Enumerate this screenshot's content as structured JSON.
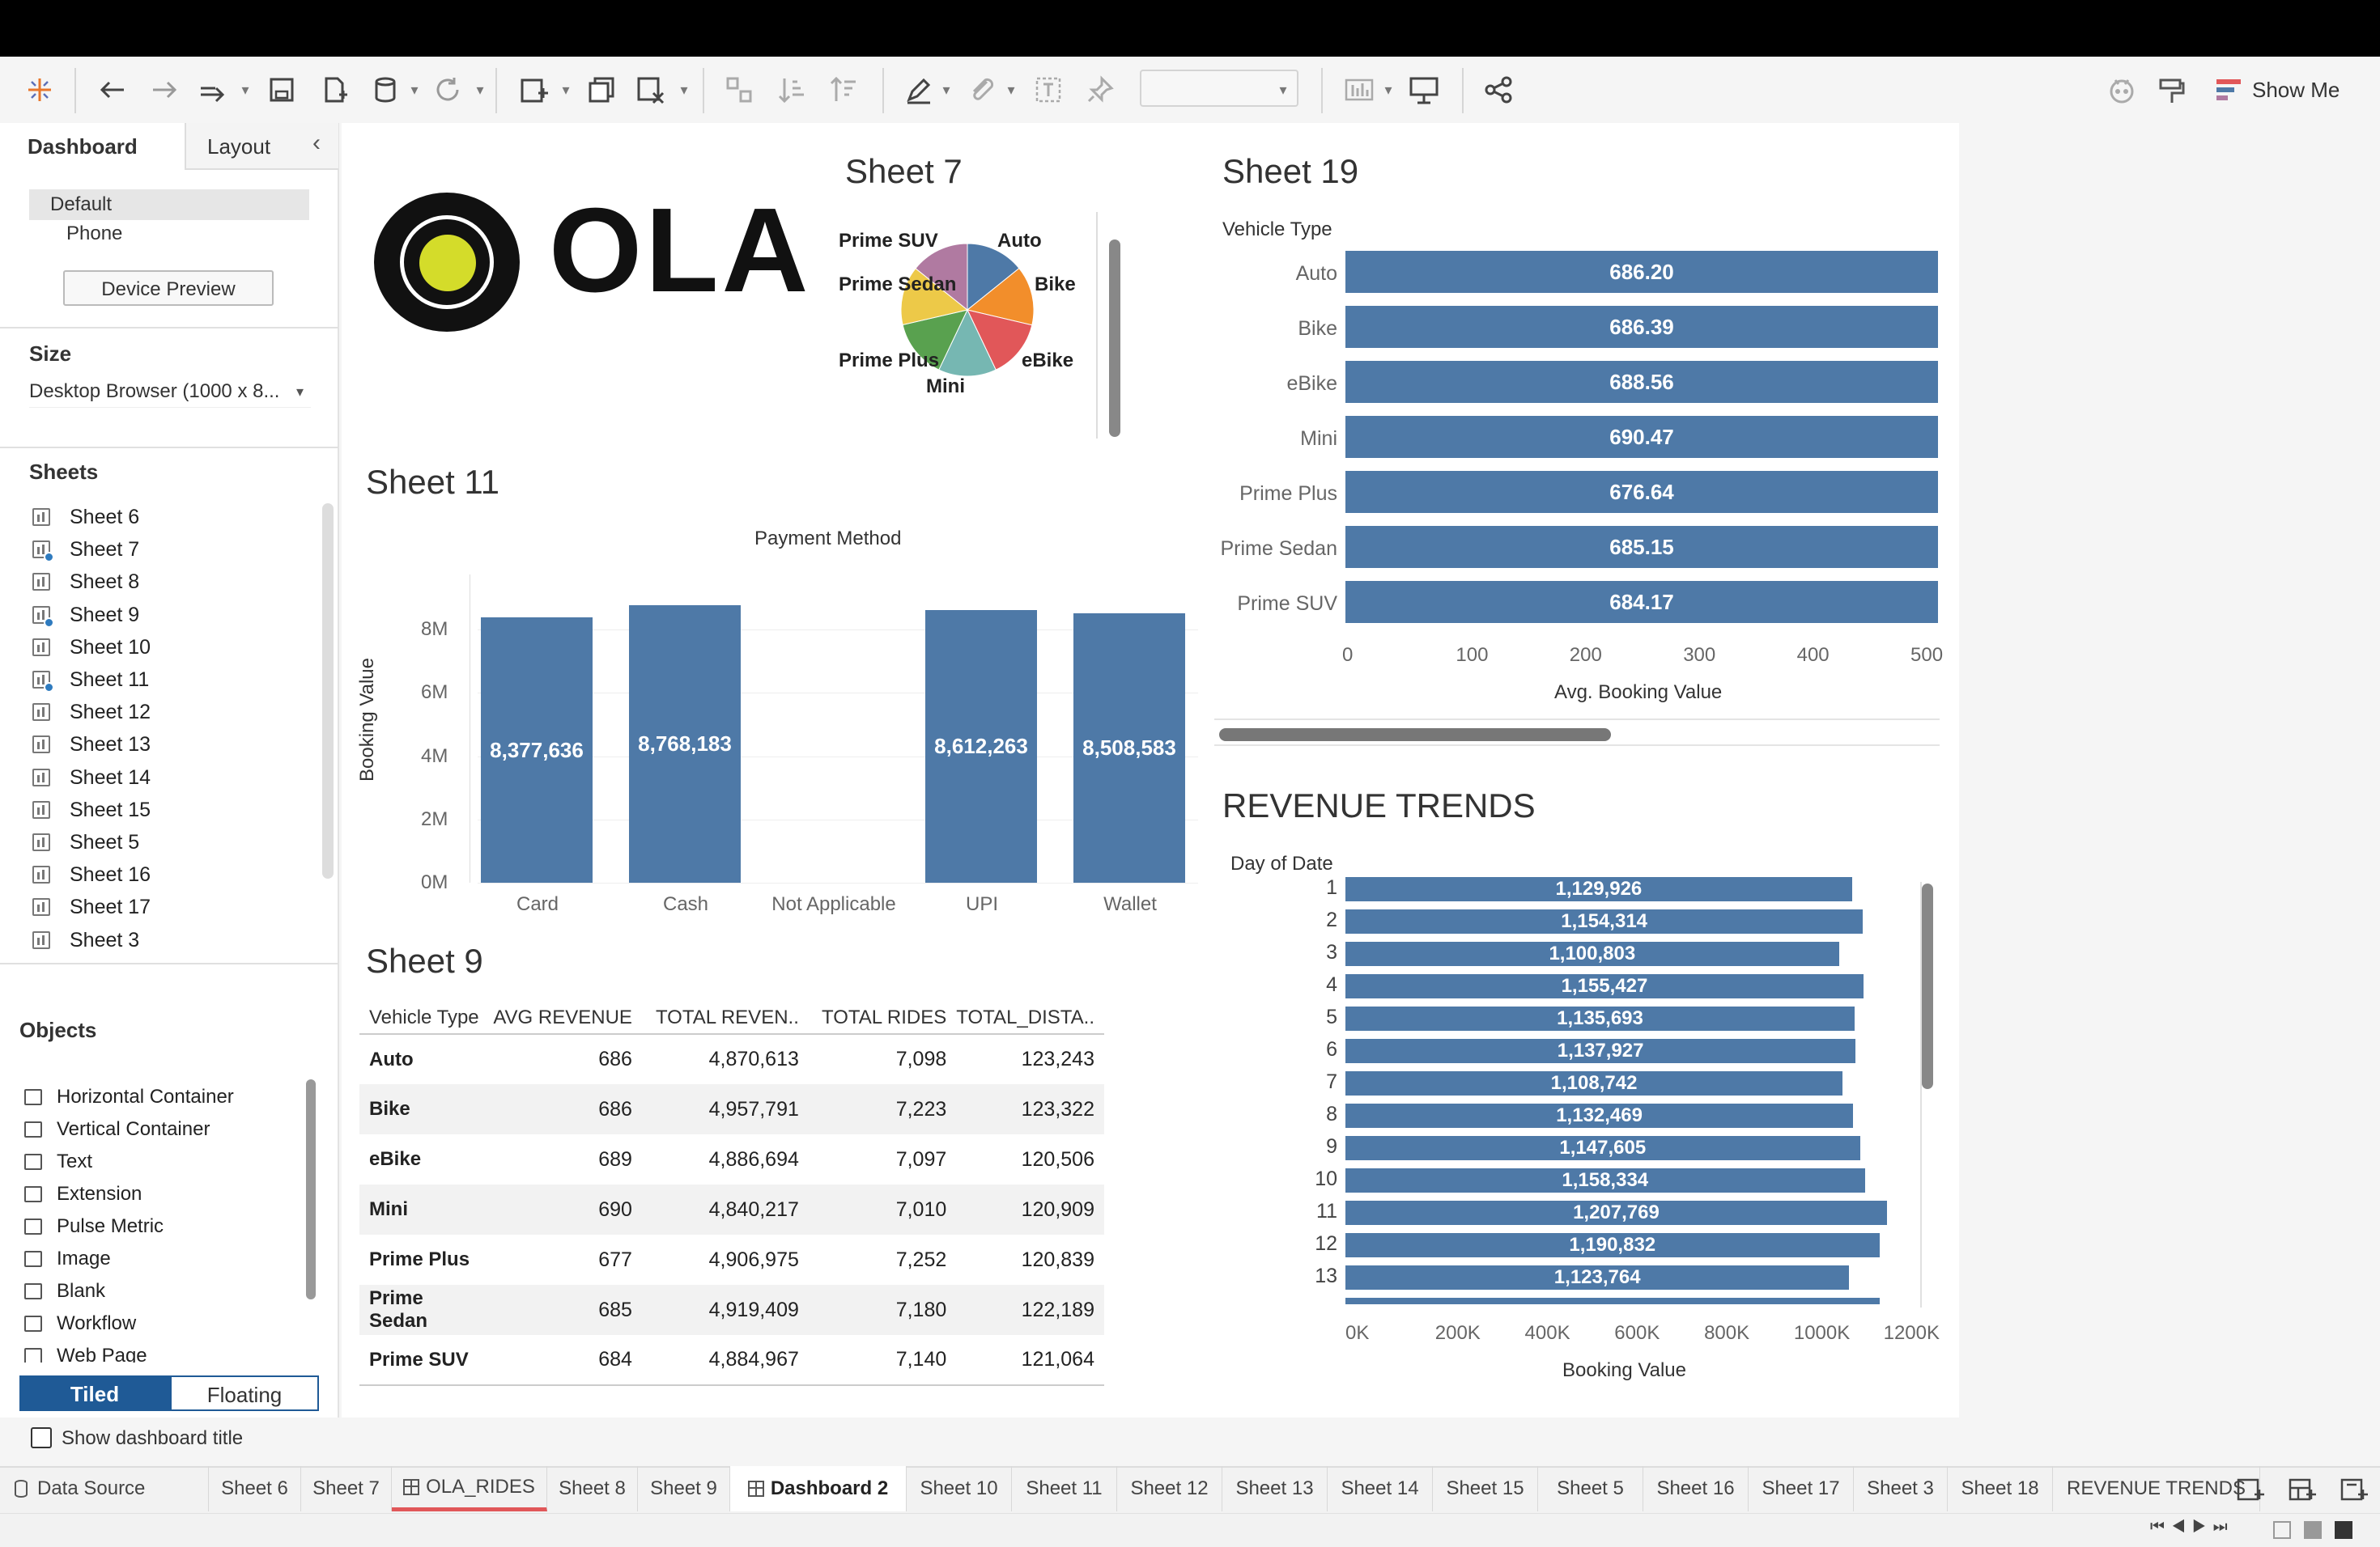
{
  "toolbar": {
    "show_me": "Show Me"
  },
  "sidebar": {
    "tabs": {
      "dashboard": "Dashboard",
      "layout": "Layout"
    },
    "devices": {
      "default": "Default",
      "phone": "Phone",
      "preview": "Device Preview"
    },
    "size": {
      "title": "Size",
      "value": "Desktop Browser (1000 x 8..."
    },
    "sheets": {
      "title": "Sheets",
      "items": [
        "Sheet 6",
        "Sheet 7",
        "Sheet 8",
        "Sheet 9",
        "Sheet 10",
        "Sheet 11",
        "Sheet 12",
        "Sheet 13",
        "Sheet 14",
        "Sheet 15",
        "Sheet 5",
        "Sheet 16",
        "Sheet 17",
        "Sheet 3"
      ],
      "used": [
        false,
        true,
        false,
        true,
        false,
        true,
        false,
        false,
        false,
        false,
        false,
        false,
        false,
        false
      ]
    },
    "objects": {
      "title": "Objects",
      "items": [
        "Horizontal Container",
        "Vertical Container",
        "Text",
        "Extension",
        "Pulse Metric",
        "Image",
        "Blank",
        "Workflow",
        "Web Page"
      ],
      "icons": [
        "horizontal-container-icon",
        "vertical-container-icon",
        "text-icon",
        "extension-icon",
        "pulse-metric-icon",
        "image-icon",
        "blank-icon",
        "workflow-icon",
        "web-page-icon"
      ]
    },
    "tiled": "Tiled",
    "floating": "Floating",
    "show_title": "Show dashboard title"
  },
  "logo": {
    "text": "OLA"
  },
  "sheet7": {
    "title": "Sheet 7",
    "labels": [
      "Prime SUV",
      "Auto",
      "Prime Sedan",
      "Bike",
      "Prime Plus",
      "eBike",
      "Mini"
    ]
  },
  "sheet19": {
    "title": "Sheet 19",
    "header": "Vehicle Type",
    "xlabel": "Avg. Booking Value",
    "ticks": [
      "0",
      "100",
      "200",
      "300",
      "400",
      "500"
    ]
  },
  "sheet11": {
    "title": "Sheet 11",
    "header": "Payment Method",
    "ylabel": "Booking Value",
    "yticks": [
      "8M",
      "6M",
      "4M",
      "2M",
      "0M"
    ]
  },
  "sheet9": {
    "title": "Sheet 9",
    "columns": [
      "Vehicle Type",
      "AVG REVENUE",
      "TOTAL REVEN..",
      "TOTAL RIDES",
      "TOTAL_DISTA.."
    ],
    "rows": [
      [
        "Auto",
        "686",
        "4,870,613",
        "7,098",
        "123,243"
      ],
      [
        "Bike",
        "686",
        "4,957,791",
        "7,223",
        "123,322"
      ],
      [
        "eBike",
        "689",
        "4,886,694",
        "7,097",
        "120,506"
      ],
      [
        "Mini",
        "690",
        "4,840,217",
        "7,010",
        "120,909"
      ],
      [
        "Prime Plus",
        "677",
        "4,906,975",
        "7,252",
        "120,839"
      ],
      [
        "Prime Sedan",
        "685",
        "4,919,409",
        "7,180",
        "122,189"
      ],
      [
        "Prime SUV",
        "684",
        "4,884,967",
        "7,140",
        "121,064"
      ]
    ]
  },
  "revenue": {
    "title": "REVENUE TRENDS",
    "header": "Day of Date",
    "xlabel": "Booking Value",
    "ticks": [
      "0K",
      "200K",
      "400K",
      "600K",
      "800K",
      "1000K",
      "1200K"
    ]
  },
  "chart_data": [
    {
      "type": "pie",
      "title": "Sheet 7",
      "categories": [
        "Auto",
        "Bike",
        "eBike",
        "Mini",
        "Prime Plus",
        "Prime Sedan",
        "Prime SUV"
      ],
      "values": [
        4870613,
        4957791,
        4886694,
        4840217,
        4906975,
        4919409,
        4884967
      ],
      "colors": [
        "#4e79a7",
        "#f28e2b",
        "#e15759",
        "#76b7b2",
        "#59a14f",
        "#edc948",
        "#b07aa1"
      ]
    },
    {
      "type": "bar",
      "title": "Sheet 19",
      "orientation": "horizontal",
      "categories": [
        "Auto",
        "Bike",
        "eBike",
        "Mini",
        "Prime Plus",
        "Prime Sedan",
        "Prime SUV"
      ],
      "values": [
        686.2,
        686.39,
        688.56,
        690.47,
        676.64,
        685.15,
        684.17
      ],
      "labels": [
        "686.20",
        "686.39",
        "688.56",
        "690.47",
        "676.64",
        "685.15",
        "684.17"
      ],
      "xlabel": "Avg. Booking Value",
      "ylabel": "Vehicle Type",
      "xlim": [
        0,
        500
      ]
    },
    {
      "type": "bar",
      "title": "Sheet 11",
      "categories": [
        "Card",
        "Cash",
        "Not Applicable",
        "UPI",
        "Wallet"
      ],
      "values": [
        8377636,
        8768183,
        0,
        8612263,
        8508583
      ],
      "labels": [
        "8,377,636",
        "8,768,183",
        "",
        "8,612,263",
        "8,508,583"
      ],
      "xlabel": "Payment Method",
      "ylabel": "Booking Value",
      "ylim": [
        0,
        9000000
      ]
    },
    {
      "type": "bar",
      "title": "REVENUE TRENDS",
      "orientation": "horizontal",
      "categories": [
        "1",
        "2",
        "3",
        "4",
        "5",
        "6",
        "7",
        "8",
        "9",
        "10",
        "11",
        "12",
        "13"
      ],
      "values": [
        1129926,
        1154314,
        1100803,
        1155427,
        1135693,
        1137927,
        1108742,
        1132469,
        1147605,
        1158334,
        1207769,
        1190832,
        1123764
      ],
      "labels": [
        "1,129,926",
        "1,154,314",
        "1,100,803",
        "1,155,427",
        "1,135,693",
        "1,137,927",
        "1,108,742",
        "1,132,469",
        "1,147,605",
        "1,158,334",
        "1,207,769",
        "1,190,832",
        "1,123,764"
      ],
      "xlabel": "Booking Value",
      "ylabel": "Day of Date",
      "xlim": [
        0,
        1300000
      ]
    }
  ],
  "tabs": {
    "data_source": "Data Source",
    "items": [
      "Sheet 6",
      "Sheet 7",
      "OLA_RIDES",
      "Sheet 8",
      "Sheet 9",
      "Dashboard 2",
      "Sheet 10",
      "Sheet 11",
      "Sheet 12",
      "Sheet 13",
      "Sheet 14",
      "Sheet 15",
      "Sheet 5",
      "Sheet 16",
      "Sheet 17",
      "Sheet 3",
      "Sheet 18",
      "REVENUE TRENDS"
    ],
    "active": "Dashboard 2"
  }
}
